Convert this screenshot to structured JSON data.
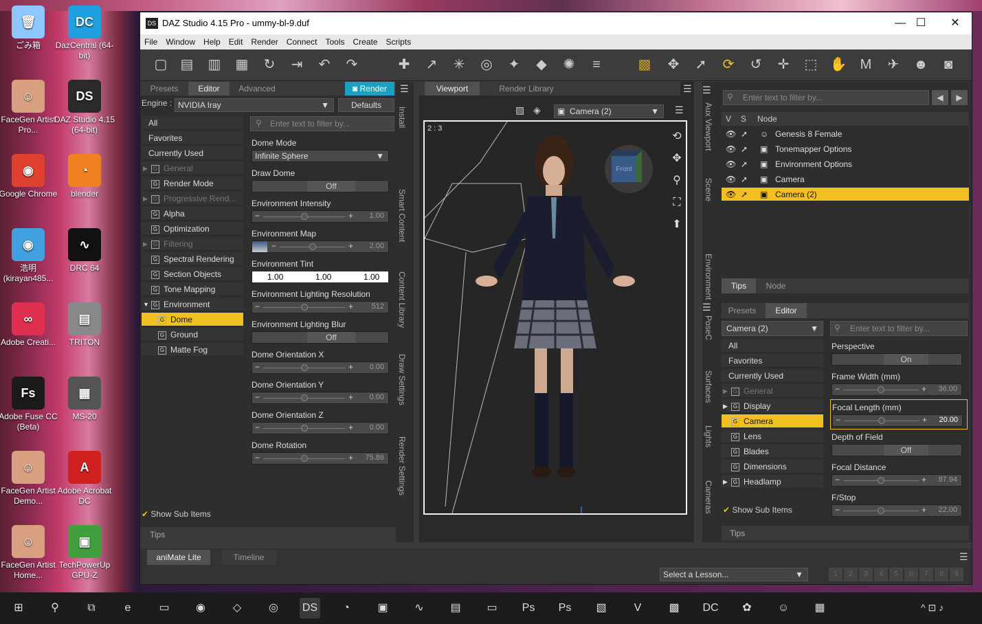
{
  "desktop": {
    "icons": [
      {
        "label": "ごみ箱",
        "glyph": "🗑",
        "color": "#8cc8ff"
      },
      {
        "label": "DazCentral (64-bit)",
        "glyph": "DC",
        "color": "#20a0e0"
      },
      {
        "label": "FaceGen Artist Pro...",
        "glyph": "☺",
        "color": "#d8a080"
      },
      {
        "label": "DAZ Studio 4.15 (64-bit)",
        "glyph": "DS",
        "color": "#2a2a2a"
      },
      {
        "label": "Google Chrome",
        "glyph": "◉",
        "color": "#e04030"
      },
      {
        "label": "blender",
        "glyph": "◔",
        "color": "#f08020"
      },
      {
        "label": "浩明 (kirayan485...",
        "glyph": "◉",
        "color": "#40a0e0"
      },
      {
        "label": "DRC 64",
        "glyph": "∿",
        "color": "#111"
      },
      {
        "label": "Adobe Creati...",
        "glyph": "∞",
        "color": "#e03050"
      },
      {
        "label": "TRITON",
        "glyph": "▤",
        "color": "#888"
      },
      {
        "label": "Adobe Fuse CC (Beta)",
        "glyph": "Fs",
        "color": "#1a1a1a"
      },
      {
        "label": "MS-20",
        "glyph": "▦",
        "color": "#555"
      },
      {
        "label": "FaceGen Artist Demo...",
        "glyph": "☺",
        "color": "#d8a080"
      },
      {
        "label": "Adobe Acrobat DC",
        "glyph": "A",
        "color": "#d02020"
      },
      {
        "label": "FaceGen Artist Home...",
        "glyph": "☺",
        "color": "#d8a080"
      },
      {
        "label": "TechPowerUp GPU-Z",
        "glyph": "▣",
        "color": "#40a040"
      }
    ]
  },
  "window": {
    "title": "DAZ Studio 4.15 Pro - ummy-bl-9.duf",
    "logo": "DS",
    "controls": [
      "—",
      "☐",
      "✕"
    ],
    "menu": [
      "File",
      "Window",
      "Help",
      "Edit",
      "Render",
      "Connect",
      "Tools",
      "Create",
      "Scripts"
    ],
    "render_settings": {
      "tabs": [
        "Presets",
        "Editor",
        "Advanced"
      ],
      "render_button": "Render",
      "engine_label": "Engine :",
      "engine_value": "NVIDIA Iray",
      "defaults_button": "Defaults",
      "filter_placeholder": "Enter text to filter by...",
      "groups": [
        {
          "label": "All",
          "kind": "plain",
          "state": ""
        },
        {
          "label": "Favorites",
          "kind": "plain",
          "state": ""
        },
        {
          "label": "Currently Used",
          "kind": "plain",
          "state": ""
        },
        {
          "label": "General",
          "kind": "g",
          "state": "dim",
          "arrow": "▶"
        },
        {
          "label": "Render Mode",
          "kind": "g",
          "state": "",
          "arrow": ""
        },
        {
          "label": "Progressive Rend...",
          "kind": "g",
          "state": "dim",
          "arrow": "▶"
        },
        {
          "label": "Alpha",
          "kind": "g",
          "state": "",
          "arrow": ""
        },
        {
          "label": "Optimization",
          "kind": "g",
          "state": "",
          "arrow": ""
        },
        {
          "label": "Filtering",
          "kind": "g",
          "state": "dim",
          "arrow": "▶"
        },
        {
          "label": "Spectral Rendering",
          "kind": "g",
          "state": "",
          "arrow": ""
        },
        {
          "label": "Section Objects",
          "kind": "g",
          "state": "",
          "arrow": ""
        },
        {
          "label": "Tone Mapping",
          "kind": "g",
          "state": "",
          "arrow": ""
        },
        {
          "label": "Environment",
          "kind": "g",
          "state": "",
          "arrow": "▼"
        },
        {
          "label": "Dome",
          "kind": "g2",
          "state": "sel",
          "arrow": ""
        },
        {
          "label": "Ground",
          "kind": "g2",
          "state": "",
          "arrow": ""
        },
        {
          "label": "Matte Fog",
          "kind": "g2",
          "state": "",
          "arrow": ""
        }
      ],
      "show_sub_items": "Show Sub Items",
      "tips": "Tips",
      "properties": [
        {
          "label": "Dome Mode",
          "type": "dropdown",
          "value": "Infinite Sphere"
        },
        {
          "label": "Draw Dome",
          "type": "toggle",
          "value": "Off"
        },
        {
          "label": "Environment Intensity",
          "type": "slider",
          "value": "1.00",
          "minus": "−",
          "plus": "+"
        },
        {
          "label": "Environment Map",
          "type": "slider-map",
          "value": "2.00",
          "minus": "−",
          "plus": "+"
        },
        {
          "label": "Environment Tint",
          "type": "color",
          "values": [
            "1.00",
            "1.00",
            "1.00"
          ]
        },
        {
          "label": "Environment Lighting Resolution",
          "type": "slider",
          "value": "512",
          "minus": "−",
          "plus": "+"
        },
        {
          "label": "Environment Lighting Blur",
          "type": "toggle",
          "value": "Off"
        },
        {
          "label": "Dome Orientation X",
          "type": "slider",
          "value": "0.00",
          "minus": "−",
          "plus": "+"
        },
        {
          "label": "Dome Orientation Y",
          "type": "slider",
          "value": "0.00",
          "minus": "−",
          "plus": "+"
        },
        {
          "label": "Dome Orientation Z",
          "type": "slider",
          "value": "0.00",
          "minus": "−",
          "plus": "+"
        },
        {
          "label": "Dome Rotation",
          "type": "slider",
          "value": "75.86",
          "minus": "−",
          "plus": "+"
        }
      ],
      "side_tabs": [
        "Install",
        "Smart Content",
        "Content Library",
        "Draw Settings",
        "Render Settings"
      ]
    },
    "viewport": {
      "tabs": [
        "Viewport",
        "Render Library"
      ],
      "camera": "Camera (2)",
      "aspect": "2 : 3",
      "cube_label": "Front"
    },
    "scene": {
      "filter_placeholder": "Enter text to filter by...",
      "cols": [
        "V",
        "S",
        "Node"
      ],
      "nodes": [
        {
          "label": "Genesis 8 Female",
          "sel": false
        },
        {
          "label": "Tonemapper Options",
          "sel": false
        },
        {
          "label": "Environment Options",
          "sel": false
        },
        {
          "label": "Camera",
          "sel": false
        },
        {
          "label": "Camera (2)",
          "sel": true
        }
      ],
      "tabs": [
        "Tips",
        "Node"
      ],
      "side_tabs": [
        "Aux Viewport",
        "Scene",
        "Environment"
      ]
    },
    "params": {
      "tabs": [
        "Presets",
        "Editor"
      ],
      "node": "Camera (2)",
      "filter_placeholder": "Enter text to filter by...",
      "groups": [
        {
          "label": "All",
          "kind": "plain",
          "state": "",
          "arrow": ""
        },
        {
          "label": "Favorites",
          "kind": "plain",
          "state": "",
          "arrow": ""
        },
        {
          "label": "Currently Used",
          "kind": "plain",
          "state": "",
          "arrow": ""
        },
        {
          "label": "General",
          "kind": "g",
          "state": "dim",
          "arrow": "▶"
        },
        {
          "label": "Display",
          "kind": "g",
          "state": "",
          "arrow": "▶"
        },
        {
          "label": "Camera",
          "kind": "g",
          "state": "sel",
          "arrow": ""
        },
        {
          "label": "Lens",
          "kind": "g",
          "state": "",
          "arrow": ""
        },
        {
          "label": "Blades",
          "kind": "g",
          "state": "",
          "arrow": ""
        },
        {
          "label": "Dimensions",
          "kind": "g",
          "state": "",
          "arrow": ""
        },
        {
          "label": "Headlamp",
          "kind": "g",
          "state": "",
          "arrow": "▶"
        }
      ],
      "show_sub_items": "Show Sub Items",
      "tips": "Tips",
      "properties": [
        {
          "label": "Perspective",
          "type": "toggle",
          "value": "On"
        },
        {
          "label": "Frame Width (mm)",
          "type": "slider",
          "value": "36.00",
          "minus": "−",
          "plus": "+"
        },
        {
          "label": "Focal Length (mm)",
          "type": "slider",
          "value": "20.00",
          "minus": "−",
          "plus": "+",
          "hl": true
        },
        {
          "label": "Depth of Field",
          "type": "toggle",
          "value": "Off"
        },
        {
          "label": "Focal Distance",
          "type": "slider",
          "value": "87.94",
          "minus": "−",
          "plus": "+"
        },
        {
          "label": "F/Stop",
          "type": "slider",
          "value": "22.00",
          "minus": "−",
          "plus": "+"
        }
      ],
      "side_tabs": [
        "PoseC",
        "Surfaces",
        "Lights",
        "Cameras"
      ]
    },
    "bottom": {
      "tabs": [
        "aniMate Lite",
        "Timeline"
      ],
      "lesson": "Select a Lesson...",
      "pages": [
        "1",
        "2",
        "3",
        "4",
        "5",
        "6",
        "7",
        "8",
        "9"
      ]
    }
  },
  "taskbar": {
    "items": [
      "⊞",
      "⚲",
      "⧉",
      "e",
      "▭",
      "◉",
      "◇",
      "◎",
      "DS",
      "◔",
      "▣",
      "∿",
      "▤",
      "▭",
      "Ps",
      "Ps",
      "▧",
      "V",
      "▩",
      "DC",
      "✿",
      "☺",
      "▦"
    ],
    "tray": "^ ⊡ ♪"
  }
}
